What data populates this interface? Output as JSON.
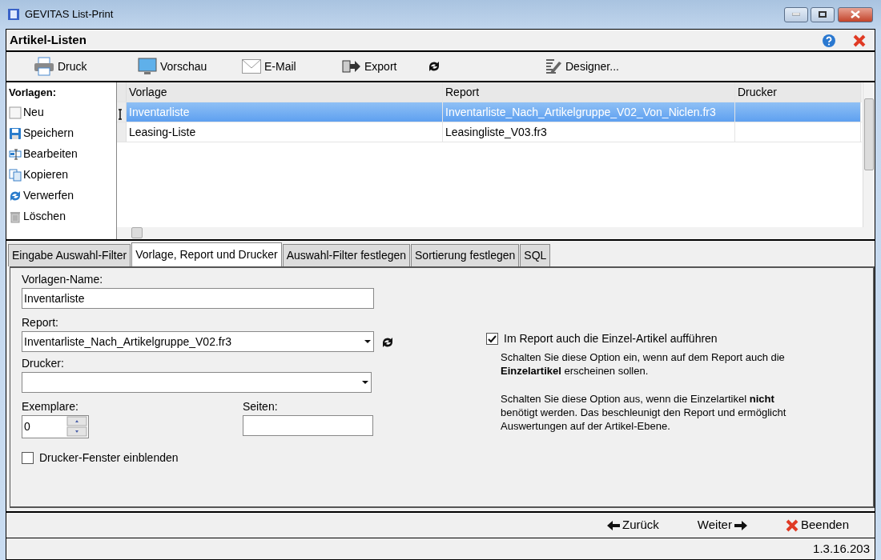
{
  "window": {
    "title": "GEVITAS List-Print"
  },
  "header": {
    "title": "Artikel-Listen"
  },
  "toolbar": [
    {
      "kind": "button",
      "label": "Druck"
    },
    {
      "kind": "button",
      "label": "Vorschau"
    },
    {
      "kind": "button",
      "label": "E-Mail"
    },
    {
      "kind": "button",
      "label": "Export"
    },
    {
      "kind": "icon"
    },
    {
      "kind": "button",
      "label": "Designer..."
    }
  ],
  "sidebar": {
    "title": "Vorlagen:",
    "items": [
      "Neu",
      "Speichern",
      "Bearbeiten",
      "Kopieren",
      "Verwerfen",
      "Löschen"
    ]
  },
  "table": {
    "columns": [
      "Vorlage",
      "Report",
      "Drucker"
    ],
    "rows": [
      {
        "cells": [
          "Inventarliste",
          "Inventarliste_Nach_Artikelgruppe_V02_Von_Niclen.fr3"
        ],
        "selected": true
      },
      {
        "cells": [
          "Leasing-Liste",
          "Leasingliste_V03.fr3"
        ],
        "selected": false
      }
    ]
  },
  "tabs": [
    {
      "label": "Eingabe Auswahl-Filter",
      "selected": false
    },
    {
      "label": "Vorlage, Report und Drucker",
      "selected": true
    },
    {
      "label": "Auswahl-Filter festlegen",
      "selected": false
    },
    {
      "label": "Sortierung festlegen",
      "selected": false
    },
    {
      "label": "SQL",
      "selected": false
    }
  ],
  "form": {
    "name_label": "Vorlagen-Name:",
    "name_value": "Inventarliste",
    "report_label": "Report:",
    "report_value": "Inventarliste_Nach_Artikelgruppe_V02.fr3",
    "printer_label": "Drucker:",
    "copies_label": "Exemplare:",
    "copies_value": "0",
    "pages_label": "Seiten:",
    "show_printer_window": {
      "label": "Drucker-Fenster einblenden",
      "checked": false
    },
    "include_items": {
      "label": "Im Report auch die Einzel-Artikel aufführen",
      "checked": true
    },
    "help": [
      "Schalten Sie diese Option ein, wenn auf dem Report auch die **Einzelartikel** erscheinen sollen.",
      "Schalten Sie diese Option aus, wenn die Einzelartikel **nicht** benötigt werden. Das beschleunigt den Report und ermöglicht Auswertungen auf der Artikel-Ebene."
    ]
  },
  "footer": {
    "buttons": [
      "Zurück",
      "Weiter",
      "Beenden"
    ]
  },
  "status_bar": {
    "version": "1.3.16.203"
  }
}
